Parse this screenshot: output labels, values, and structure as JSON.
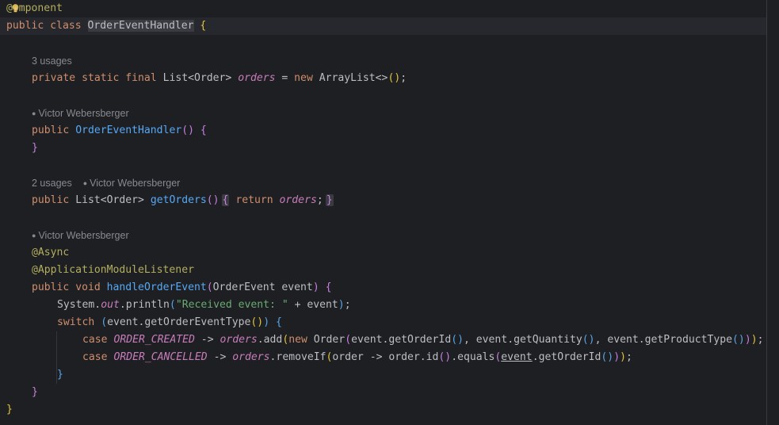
{
  "editor": {
    "code": {
      "l1_at": "@",
      "l1_rest": "omponent",
      "l2_public": "public",
      "l2_class": "class",
      "l2_name": "OrderEventHandler",
      "l2_brace": "{",
      "l5_private": "private",
      "l5_static": "static",
      "l5_final": "final",
      "l5_type": "List<Order>",
      "l5_field": "orders",
      "l5_eq": " = ",
      "l5_new": "new",
      "l5_arraylist": "ArrayList<>",
      "l5_parens": "()",
      "l5_semi": ";",
      "l8_public": "public",
      "l8_ctor": "OrderEventHandler",
      "l8_parens": "()",
      "l8_brace": "{",
      "l9_close": "}",
      "l12_public": "public",
      "l12_type": "List<Order>",
      "l12_method": "getOrders",
      "l12_parens": "()",
      "l12_fold_open": "{",
      "l12_return": "return",
      "l12_field": "orders",
      "l12_semi": ";",
      "l12_fold_close": "}",
      "l15_annotation": "@Async",
      "l16_annotation": "@ApplicationModuleListener",
      "l17_public": "public",
      "l17_void": "void",
      "l17_method": "handleOrderEvent",
      "l17_open": "(",
      "l17_param": "OrderEvent event",
      "l17_close": ")",
      "l17_brace": "{",
      "l18_system": "System.",
      "l18_out": "out",
      "l18_println": ".println",
      "l18_open": "(",
      "l18_string": "\"Received event: \"",
      "l18_concat": " + event",
      "l18_close": ")",
      "l18_semi": ";",
      "l19_switch": "switch",
      "l19_open": "(",
      "l19_expr": "event.getOrderEventType",
      "l19_inner": "()",
      "l19_close": ")",
      "l19_brace": "{",
      "l20_case": "case",
      "l20_const": "ORDER_CREATED",
      "l20_arrow": " -> ",
      "l20_field": "orders",
      "l20_add": ".add",
      "l20_open": "(",
      "l20_new": "new",
      "l20_order": "Order",
      "l20_open2": "(",
      "l20_getid": "event.getOrderId",
      "l20_p1": "()",
      "l20_comma1": ", ",
      "l20_getqty": "event.getQuantity",
      "l20_p2": "()",
      "l20_comma2": ", ",
      "l20_getprod": "event.getProductType",
      "l20_p3": "()",
      "l20_close2": ")",
      "l20_close1": ")",
      "l20_semi": ";",
      "l21_case": "case",
      "l21_const": "ORDER_CANCELLED",
      "l21_arrow": " -> ",
      "l21_field": "orders",
      "l21_remove": ".removeIf",
      "l21_open": "(",
      "l21_lambda": "order -> order.id",
      "l21_p1": "()",
      "l21_equals": ".equals",
      "l21_open2": "(",
      "l21_event": "event",
      "l21_getid": ".getOrderId",
      "l21_p2": "()",
      "l21_close2": ")",
      "l21_close1": ")",
      "l21_semi": ";",
      "l22_close": "}",
      "l23_close": "}",
      "l24_close": "}"
    },
    "hints": {
      "orders_usages": "3 usages",
      "ctor_author": "Victor Webersberger",
      "getorders_usages": "2 usages",
      "getorders_author": "Victor Webersberger",
      "handle_author": "Victor Webersberger"
    },
    "icons": {
      "intention": "bulb-icon",
      "author": "person-icon"
    },
    "colors": {
      "background": "#1e1f22",
      "keyword": "#cf8e6d",
      "annotation": "#b3ae60",
      "method": "#56a8f5",
      "field": "#c77dbb",
      "string": "#6aab73",
      "hint": "#868a91"
    }
  }
}
